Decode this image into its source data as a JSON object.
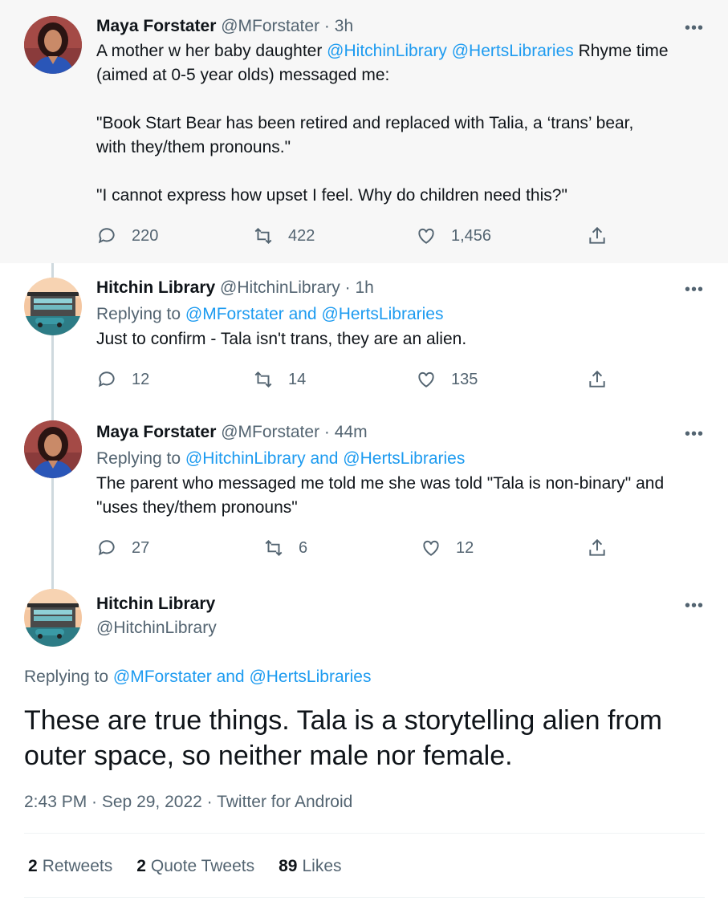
{
  "colors": {
    "link": "#1d9bf0",
    "muted": "#536471",
    "text": "#0f1419",
    "thread_line": "#cfd9de"
  },
  "tweets": [
    {
      "name": "Maya Forstater",
      "handle": "@MForstater",
      "dot": "·",
      "time": "3h",
      "body": [
        {
          "pre": "A mother w her baby daughter ",
          "m1": "@HitchinLibrary",
          "sp": " ",
          "m2": "@HertsLibraries",
          "post": " Rhyme time"
        },
        "(aimed at 0-5 year olds) messaged me:",
        "\"Book Start Bear has been retired and replaced with Talia, a ‘trans’ bear,",
        "with they/them pronouns.\"",
        "\"I cannot express how upset I feel. Why do children need this?\""
      ],
      "replies": "220",
      "retweets": "422",
      "likes": "1,456"
    },
    {
      "name": "Hitchin Library",
      "handle": "@HitchinLibrary",
      "dot": "·",
      "time": "1h",
      "replying_prefix": "Replying to ",
      "replying_to": "@MForstater and @HertsLibraries",
      "body": [
        "Just to confirm - Tala isn't trans, they are an alien."
      ],
      "replies": "12",
      "retweets": "14",
      "likes": "135"
    },
    {
      "name": "Maya Forstater",
      "handle": "@MForstater",
      "dot": "·",
      "time": "44m",
      "replying_prefix": "Replying to ",
      "replying_to": "@HitchinLibrary and @HertsLibraries",
      "body": [
        "The parent who messaged me told me she was told \"Tala is non-binary\" and",
        "\"uses they/them pronouns\""
      ],
      "replies": "27",
      "retweets": "6",
      "likes": "12"
    }
  ],
  "main_tweet": {
    "name": "Hitchin Library",
    "handle": "@HitchinLibrary",
    "replying_prefix": "Replying to ",
    "replying_to": "@MForstater and @HertsLibraries",
    "text_line1": "These are true things. Tala is a storytelling alien from",
    "text_line2": "outer space, so neither male nor female.",
    "timestamp": "2:43 PM · Sep 29, 2022 · Twitter for Android",
    "retweets_count": "2",
    "retweets_label": "Retweets",
    "quotes_count": "2",
    "quotes_label": "Quote Tweets",
    "likes_count": "89",
    "likes_label": "Likes"
  },
  "icons": [
    "reply-icon",
    "retweet-icon",
    "like-icon",
    "share-icon",
    "more-icon"
  ]
}
